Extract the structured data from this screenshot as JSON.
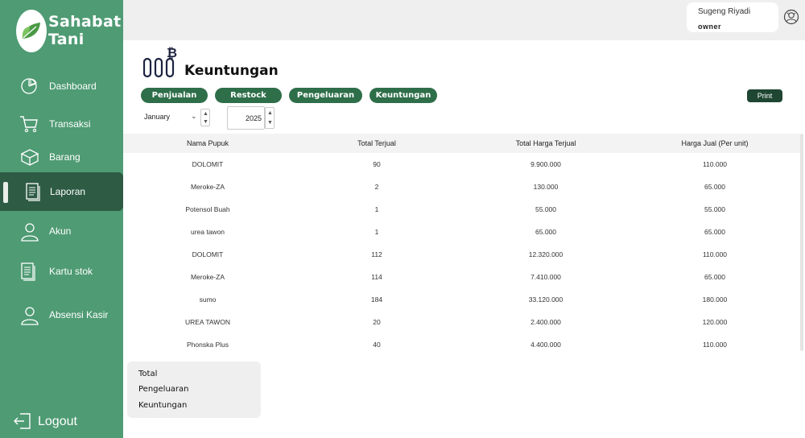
{
  "brand": {
    "line1": "Sahabat",
    "line2": "Tani"
  },
  "sidebar": {
    "items": [
      {
        "label": "Dashboard"
      },
      {
        "label": "Transaksi"
      },
      {
        "label": "Barang"
      },
      {
        "label": "Laporan"
      },
      {
        "label": "Akun"
      },
      {
        "label": "Kartu stok"
      },
      {
        "label": "Absensi Kasir"
      }
    ],
    "active_item": "Laporan",
    "logout": "Logout"
  },
  "user": {
    "name": "Sugeng Riyadi",
    "role": "owner"
  },
  "page": {
    "title": "Keuntungan"
  },
  "tabs": [
    {
      "label": "Penjualan"
    },
    {
      "label": "Restock"
    },
    {
      "label": "Pengeluaran"
    },
    {
      "label": "Keuntungan"
    }
  ],
  "print_label": "Print",
  "filters": {
    "month": "January",
    "year": "2025"
  },
  "table": {
    "headers": [
      "Nama Pupuk",
      "Total Terjual",
      "Total Harga Terjual",
      "Harga Jual (Per unit)"
    ],
    "rows": [
      [
        "DOLOMIT",
        "90",
        "9.900.000",
        "110.000"
      ],
      [
        "Meroke-ZA",
        "2",
        "130.000",
        "65.000"
      ],
      [
        "Potensol Buah",
        "1",
        "55.000",
        "55.000"
      ],
      [
        "urea tawon",
        "1",
        "65.000",
        "65.000"
      ],
      [
        "DOLOMIT",
        "112",
        "12.320.000",
        "110.000"
      ],
      [
        "Meroke-ZA",
        "114",
        "7.410.000",
        "65.000"
      ],
      [
        "sumo",
        "184",
        "33.120.000",
        "180.000"
      ],
      [
        "UREA TAWON",
        "20",
        "2.400.000",
        "120.000"
      ],
      [
        "Phonska Plus",
        "40",
        "4.400.000",
        "110.000"
      ]
    ]
  },
  "summary": {
    "total": "Total",
    "pengeluaran": "Pengeluaran",
    "keuntungan": "Keuntungan"
  },
  "colors": {
    "sidebar": "#4f9b74",
    "active": "#2e5b44",
    "button": "#2e6e49",
    "print": "#1f4632"
  }
}
